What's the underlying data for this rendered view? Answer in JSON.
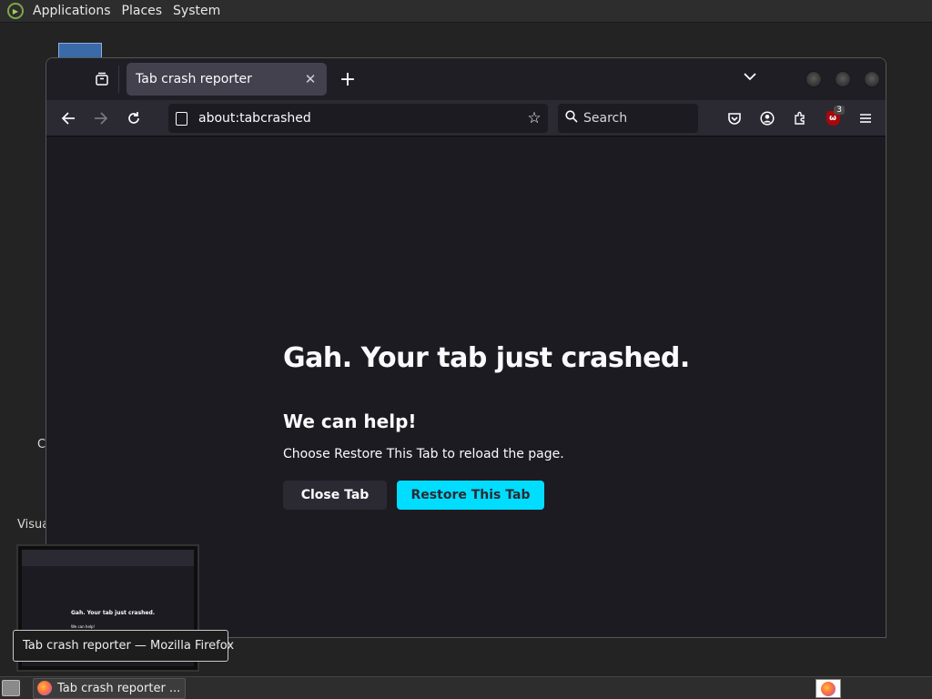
{
  "top_panel": {
    "menus": [
      "Applications",
      "Places",
      "System"
    ]
  },
  "desktop": {
    "partial_labels": [
      "C",
      "Visua"
    ]
  },
  "browser": {
    "tab": {
      "title": "Tab crash reporter",
      "close_glyph": "✕"
    },
    "new_tab_glyph": "+",
    "urlbar": {
      "url": "about:tabcrashed"
    },
    "searchbar": {
      "placeholder": "Search"
    },
    "extension_badge": "3"
  },
  "crash_page": {
    "title": "Gah. Your tab just crashed.",
    "subtitle": "We can help!",
    "description": "Choose Restore This Tab to reload the page.",
    "close_button": "Close Tab",
    "restore_button": "Restore This Tab"
  },
  "preview": {
    "title": "Gah. Your tab just crashed.",
    "subtitle": "We can help!"
  },
  "tooltip": {
    "text": "Tab crash reporter — Mozilla Firefox"
  },
  "taskbar": {
    "task_label": "Tab crash reporter ..."
  },
  "colors": {
    "accent": "#00ddff",
    "content_bg": "#1c1b22",
    "toolbar_bg": "#2b2a33"
  }
}
